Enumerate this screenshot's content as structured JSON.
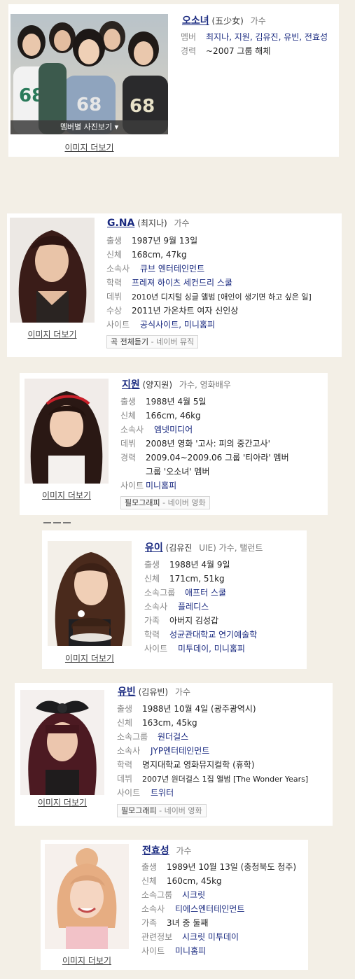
{
  "group": {
    "name": "오소녀",
    "hanja": "(五少女)",
    "role": "가수",
    "rows": [
      {
        "label": "멤버",
        "value": "최지나, 지원, 김유진, 유빈, 전효성",
        "link": true
      },
      {
        "label": "경력",
        "value": "~2007 그룹 해체",
        "link": false
      }
    ],
    "photo_bar_label": "멤버별 사진보기 ▾",
    "more_label": "이미지 더보기"
  },
  "members": [
    {
      "id": "gna",
      "name": "G.NA",
      "hanja": "(최지나)",
      "role": "가수",
      "rows": [
        {
          "label": "출생",
          "value": "1987년 9월 13일",
          "link": false
        },
        {
          "label": "신체",
          "value": "168cm, 47kg",
          "link": false
        },
        {
          "label": "소속사",
          "value": "큐브 엔터테인먼트",
          "link": true
        },
        {
          "label": "학력",
          "value": "프레져 하이츠 세컨드리 스쿨",
          "link": true
        },
        {
          "label": "데뷔",
          "value": "2010년 디지털 싱글 앨범 [애인이 생기면 하고 싶은 일]",
          "link": false
        },
        {
          "label": "수상",
          "value": "2011년 가온차트 여자 신인상",
          "link": false
        },
        {
          "label": "사이트",
          "value": "공식사이트, 미니홈피",
          "link": true
        }
      ],
      "button": {
        "label": "곡 전체듣기",
        "extra": " - 네이버 뮤직"
      },
      "more_label": "이미지 더보기"
    },
    {
      "id": "jiwon",
      "name": "지원",
      "hanja": "(양지원)",
      "role": "가수, 영화배우",
      "rows": [
        {
          "label": "출생",
          "value": "1988년 4월 5일",
          "link": false
        },
        {
          "label": "신체",
          "value": "166cm, 46kg",
          "link": false
        },
        {
          "label": "소속사",
          "value": "엠넷미디어",
          "link": true
        },
        {
          "label": "데뷔",
          "value": "2008년 영화 '고사: 피의 중간고사'",
          "link": false
        },
        {
          "label": "경력",
          "value": "2009.04~2009.06 그룹 '티아라' 멤버",
          "link": false
        },
        {
          "label": "",
          "value": "그룹 '오소녀' 멤버",
          "link": false
        },
        {
          "label": "사이트",
          "value": "미니홈피",
          "link": true
        }
      ],
      "button": {
        "label": "필모그래피",
        "extra": " - 네이버 영화"
      },
      "more_label": "이미지 더보기"
    },
    {
      "id": "uee",
      "name": "유이",
      "hanja": "(김유진",
      "role": "UIE)  가수, 탤런트",
      "rows": [
        {
          "label": "출생",
          "value": "1988년 4월 9일",
          "link": false
        },
        {
          "label": "신체",
          "value": "171cm, 51kg",
          "link": false
        },
        {
          "label": "소속그룹",
          "value": "애프터 스쿨",
          "link": true
        },
        {
          "label": "소속사",
          "value": "플레디스",
          "link": true
        },
        {
          "label": "가족",
          "value": "아버지 김성갑",
          "link": false
        },
        {
          "label": "학력",
          "value": "성균관대학교 연기예술학",
          "link": true
        },
        {
          "label": "사이트",
          "value": "미투데이, 미니홈피",
          "link": true
        }
      ],
      "more_label": "이미지 더보기"
    },
    {
      "id": "yubin",
      "name": "유빈",
      "hanja": "(김유빈)",
      "role": "가수",
      "rows": [
        {
          "label": "출생",
          "value": "1988년 10월 4일 (광주광역시)",
          "link": false
        },
        {
          "label": "신체",
          "value": "163cm, 45kg",
          "link": false
        },
        {
          "label": "소속그룹",
          "value": "원더걸스",
          "link": true
        },
        {
          "label": "소속사",
          "value": "JYP엔터테인먼트",
          "link": true
        },
        {
          "label": "학력",
          "value": "명지대학교 영화뮤지컬학 (휴학)",
          "link": false
        },
        {
          "label": "데뷔",
          "value": "2007년 원더걸스 1집 앨범 [The Wonder Years]",
          "link": false
        },
        {
          "label": "사이트",
          "value": "트위터",
          "link": true
        }
      ],
      "button": {
        "label": "필모그래피",
        "extra": " - 네이버 영화"
      },
      "more_label": "이미지 더보기"
    },
    {
      "id": "hyosung",
      "name": "전효성",
      "hanja": "",
      "role": "가수",
      "rows": [
        {
          "label": "출생",
          "value": "1989년 10월 13일 (충청북도 청주)",
          "link": false
        },
        {
          "label": "신체",
          "value": "160cm, 45kg",
          "link": false
        },
        {
          "label": "소속그룹",
          "value": "시크릿",
          "link": true
        },
        {
          "label": "소속사",
          "value": "티에스엔터테인먼트",
          "link": true
        },
        {
          "label": "가족",
          "value": "3녀 중 둘째",
          "link": false
        },
        {
          "label": "관련정보",
          "value": "시크릿 미투데이",
          "link": true
        },
        {
          "label": "사이트",
          "value": "미니홈피",
          "link": true
        }
      ],
      "more_label": "이미지 더보기"
    }
  ]
}
